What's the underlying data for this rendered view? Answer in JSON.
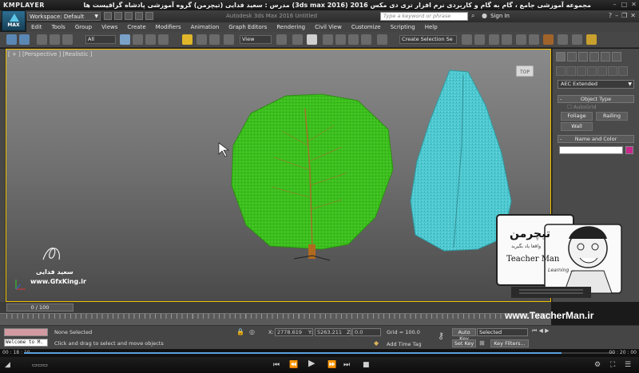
{
  "kmplayer": {
    "logo": "KMPLAYER",
    "title": "مجموعه آموزشی جامع ، گام به گام و کاربردی نرم افزار تری دی مکس 2016 (3ds max 2016) مدرس : سعید فدایی (تیچرمن) گروه آموزشی پادشاه گرافیست ها",
    "time_current": "00 : 18 : 10",
    "time_total": "00 : 20 : 00",
    "progress": 0.91
  },
  "titlebar": {
    "logo": "MAX",
    "workspace": "Workspace: Default",
    "app_title": "Autodesk 3ds Max 2016      Untitled",
    "search_placeholder": "Type a keyword or phrase",
    "signin": "Sign In"
  },
  "menu": [
    "Edit",
    "Tools",
    "Group",
    "Views",
    "Create",
    "Modifiers",
    "Animation",
    "Graph Editors",
    "Rendering",
    "Civil View",
    "Customize",
    "Scripting",
    "Help"
  ],
  "toolbar": {
    "filter": "All",
    "ref_coord": "View",
    "selection_set": "Create Selection Se"
  },
  "viewport": {
    "label": "[ + ] [Perspective ] [Realistic ]",
    "viewcube_label": "TOP"
  },
  "command_panel": {
    "category": "AEC Extended",
    "object_type_title": "Object Type",
    "autogrid": "AutoGrid",
    "buttons": [
      "Foliage",
      "Railing",
      "Wall"
    ],
    "name_color_title": "Name and Color",
    "swatch_color": "#c8288c"
  },
  "timeline": {
    "frame": "0 / 100"
  },
  "status": {
    "maxscript": "Welcome to M.",
    "selection": "None Selected",
    "prompt": "Click and drag to select and move objects",
    "x_label": "X:",
    "x_value": "2778.619",
    "y_label": "Y:",
    "y_value": "5263.211",
    "z_label": "Z:",
    "z_value": "0.0",
    "grid": "Grid = 100.0",
    "add_time_tag": "Add Time Tag",
    "auto_key": "Auto Key",
    "set_key": "Set Key",
    "selected": "Selected",
    "key_filters": "Key Filters..."
  },
  "watermarks": {
    "author_name": "سعید فدایی",
    "gfxking": "www.GfxKing.ir",
    "teacher_logo": "تیچرمن",
    "teacher_tagline": "واقعا یاد بگیرید",
    "teacher_name": "Teacher Man",
    "teacher_sub": "Learning ...",
    "teacher_url": "www.TeacherMan.ir"
  },
  "colors": {
    "leaf_green": "#3cbf1e",
    "leaf_cyan": "#4ec8d0",
    "viewport_border": "#f0c000"
  }
}
